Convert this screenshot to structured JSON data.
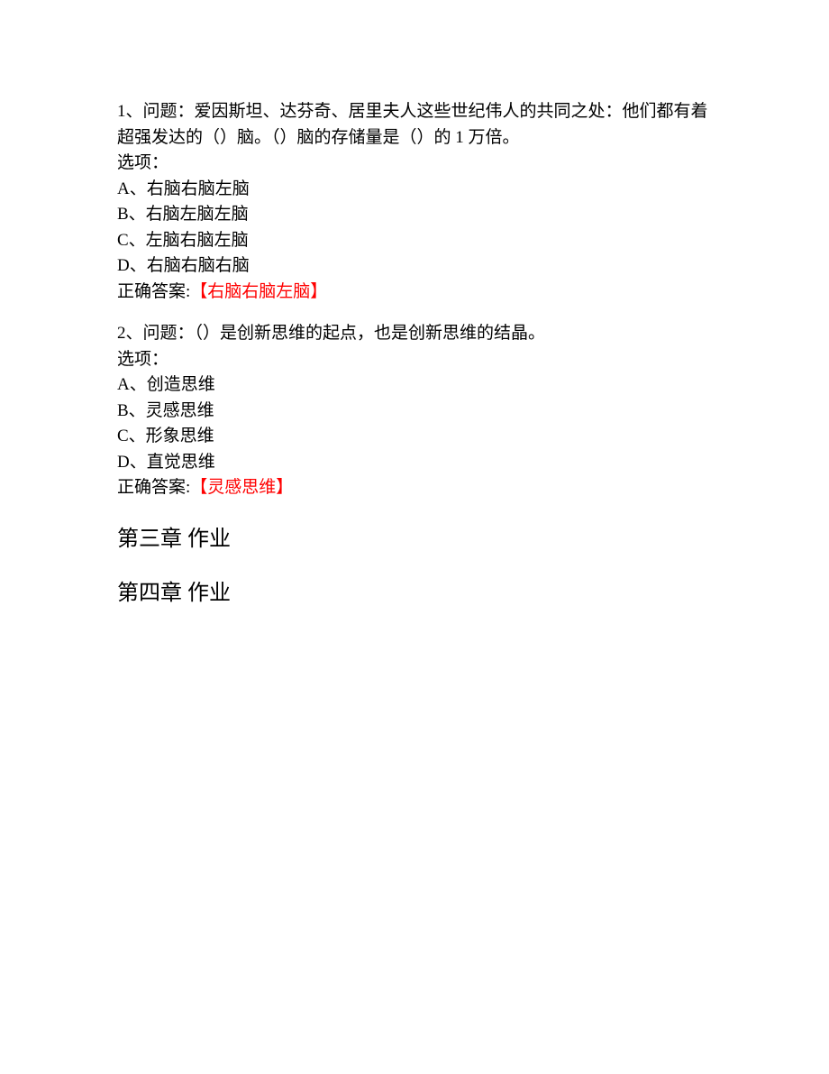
{
  "questions": [
    {
      "number": "1",
      "prompt": "1、问题：爱因斯坦、达芬奇、居里夫人这些世纪伟人的共同之处：他们都有着超强发达的（）脑。（）脑的存储量是（）的 1 万倍。",
      "options_label": "选项：",
      "options": [
        "A、右脑右脑左脑",
        "B、右脑左脑左脑",
        "C、左脑右脑左脑",
        "D、右脑右脑右脑"
      ],
      "answer_label": "正确答案:",
      "answer_value": "【右脑右脑左脑】"
    },
    {
      "number": "2",
      "prompt": "2、问题：（）是创新思维的起点，也是创新思维的结晶。",
      "options_label": "选项：",
      "options": [
        "A、创造思维",
        "B、灵感思维",
        "C、形象思维",
        "D、直觉思维"
      ],
      "answer_label": "正确答案:",
      "answer_value": "【灵感思维】"
    }
  ],
  "sections": [
    "第三章 作业",
    "第四章 作业"
  ]
}
